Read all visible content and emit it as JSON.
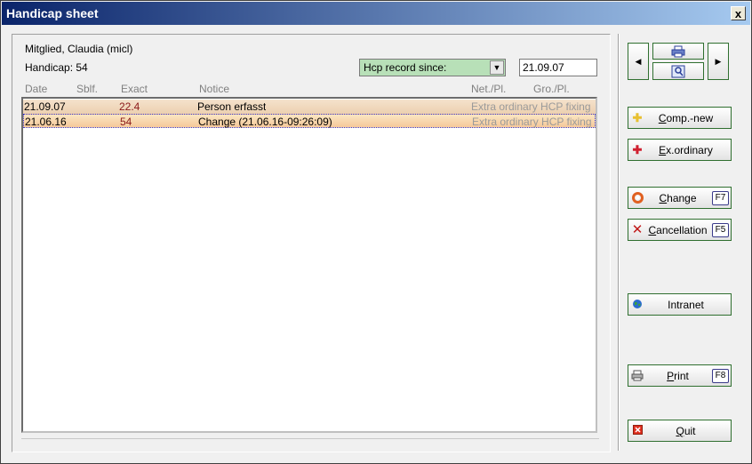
{
  "window": {
    "title": "Handicap sheet",
    "close_label": "x"
  },
  "member": {
    "name": "Mitglied, Claudia (micl)",
    "handicap": "Handicap: 54"
  },
  "filter": {
    "selected": "Hcp record since:",
    "date": "21.09.07"
  },
  "columns": [
    "Date",
    "Sblf.",
    "Exact",
    "Notice",
    "Net./Pl.",
    "Gro./Pl."
  ],
  "rows": [
    {
      "date": "21.09.07",
      "exact": "22.4",
      "notice": "Person erfasst",
      "net": "Extra ordinary HCP fixing"
    },
    {
      "date": "21.06.16",
      "exact": "54",
      "notice": "Change (21.06.16-09:26:09)",
      "net": "Extra ordinary HCP fixing"
    }
  ],
  "buttons": {
    "comp_new": {
      "pre": "",
      "ul": "C",
      "post": "omp.-new"
    },
    "exordinary": {
      "pre": "",
      "ul": "E",
      "post": "x.ordinary"
    },
    "change": {
      "pre": "",
      "ul": "C",
      "post": "hange",
      "key": "F7"
    },
    "cancellation": {
      "pre": "",
      "ul": "C",
      "post": "ancellation",
      "key": "F5"
    },
    "intranet": {
      "label": "Intranet"
    },
    "print": {
      "pre": "",
      "ul": "P",
      "post": "rint",
      "key": "F8"
    },
    "quit": {
      "pre": "",
      "ul": "Q",
      "post": "uit"
    }
  },
  "colors": {
    "title_start": "#0a246a",
    "title_end": "#a6caf0",
    "select_bg": "#b8e0b8",
    "button_border": "#2f6f2f",
    "exact_text": "#8b1a1a"
  }
}
